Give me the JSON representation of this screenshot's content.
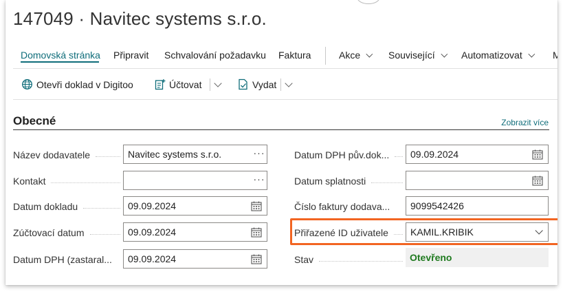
{
  "page": {
    "title": "147049 · Navitec systems s.r.o."
  },
  "nav": {
    "items": [
      {
        "label": "Domovská stránka",
        "active": true
      },
      {
        "label": "Připravit"
      },
      {
        "label": "Schvalování požadavku"
      },
      {
        "label": "Faktura"
      }
    ],
    "menus": [
      {
        "label": "Akce"
      },
      {
        "label": "Související"
      },
      {
        "label": "Automatizovat"
      },
      {
        "label": "M"
      }
    ]
  },
  "toolbar": {
    "open_digitoo": "Otevři doklad v Digitoo",
    "post": "Účtovat",
    "issue": "Vydat"
  },
  "section": {
    "title": "Obecné",
    "show_more": "Zobrazit více"
  },
  "fields": {
    "vendor_name": {
      "label": "Název dodavatele",
      "value": "Navitec systems s.r.o."
    },
    "contact": {
      "label": "Kontakt",
      "value": ""
    },
    "document_date": {
      "label": "Datum dokladu",
      "value": "09.09.2024"
    },
    "posting_date": {
      "label": "Zúčtovací datum",
      "value": "09.09.2024"
    },
    "vat_date_legacy": {
      "label": "Datum DPH (zastaral...",
      "value": "09.09.2024"
    },
    "vat_date_orig": {
      "label": "Datum DPH pův.dok...",
      "value": "09.09.2024"
    },
    "due_date": {
      "label": "Datum splatnosti",
      "value": ""
    },
    "vendor_invoice_no": {
      "label": "Číslo faktury dodava...",
      "value": "9099542426"
    },
    "assigned_user_id": {
      "label": "Přiřazené ID uživatele",
      "value": "KAMIL.KRIBIK"
    },
    "status": {
      "label": "Stav",
      "value": "Otevřeno"
    }
  },
  "colors": {
    "accent": "#0f6d7a",
    "status_open": "#1f7a1f",
    "highlight": "#f26522"
  }
}
